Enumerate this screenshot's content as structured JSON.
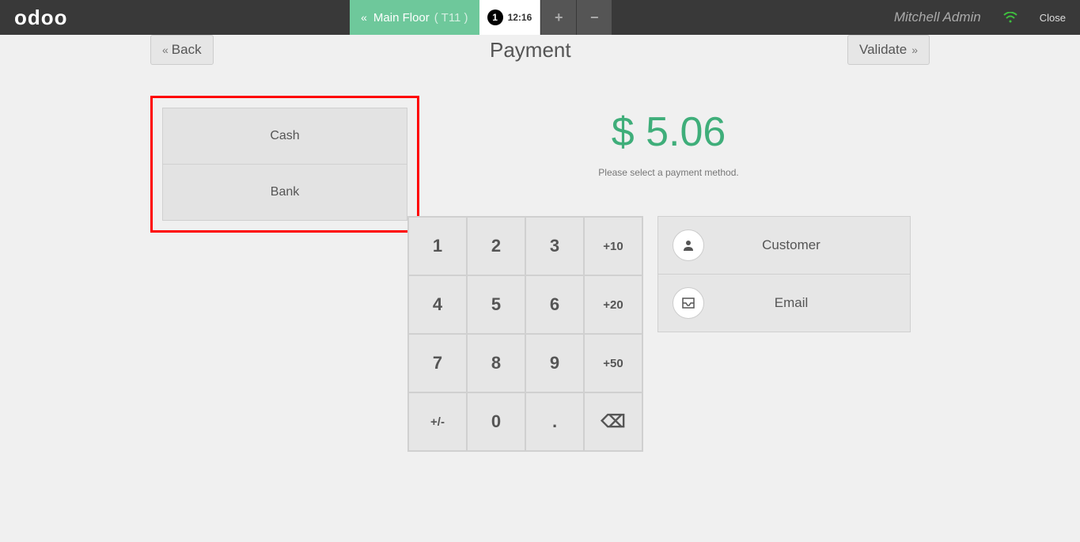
{
  "topbar": {
    "logo": "odoo",
    "floor_label": "Main Floor",
    "table_label": "( T11 )",
    "order_number": "1",
    "order_time": "12:16",
    "plus": "+",
    "minus": "−",
    "username": "Mitchell Admin",
    "close": "Close"
  },
  "header": {
    "back": "Back",
    "title": "Payment",
    "validate": "Validate"
  },
  "payment_methods": [
    "Cash",
    "Bank"
  ],
  "amount": "$ 5.06",
  "hint": "Please select a payment method.",
  "numpad": {
    "k1": "1",
    "k2": "2",
    "k3": "3",
    "p10": "+10",
    "k4": "4",
    "k5": "5",
    "k6": "6",
    "p20": "+20",
    "k7": "7",
    "k8": "8",
    "k9": "9",
    "p50": "+50",
    "sign": "+/-",
    "k0": "0",
    "dot": ".",
    "del": "⌫"
  },
  "actions": {
    "customer": "Customer",
    "email": "Email"
  }
}
